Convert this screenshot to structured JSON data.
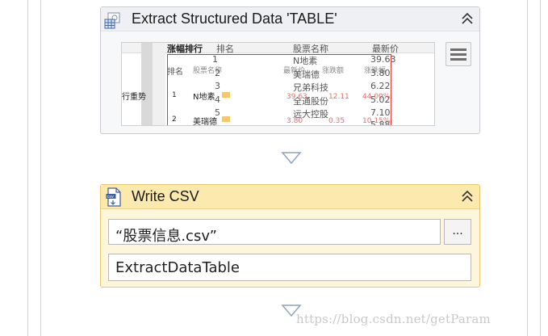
{
  "extract_activity": {
    "title": "Extract Structured Data 'TABLE'",
    "icon": "table-grid-icon",
    "collapse_icon": "double-chevron-up-icon",
    "menu_icon": "hamburger-menu-icon",
    "preview": {
      "header_row": [
        "涨幅排行",
        "排名",
        "股票名称",
        "最新价"
      ],
      "overlay_header": [
        "排名",
        "股票名称",
        "最新价",
        "涨跌额",
        "涨跌幅"
      ],
      "side_label": "行重势",
      "rows": [
        {
          "rank": "1",
          "name": "N地素",
          "price": "39.63"
        },
        {
          "rank": "2",
          "name": "美瑞德",
          "price": "3.80"
        },
        {
          "rank": "3",
          "name": "兄弟科技",
          "price": "6.22"
        },
        {
          "rank": "4",
          "name": "全通股份",
          "price": "5.02"
        },
        {
          "rank": "5",
          "name": "远大控股",
          "price": "7.10"
        },
        {
          "rank": "6",
          "name": "",
          "price": "5.88"
        }
      ],
      "overlay_rows": [
        {
          "rank": "1",
          "name": "N地素",
          "v1": "39.63",
          "v2": "12.11",
          "v3": "44.00%"
        },
        {
          "rank": "2",
          "name": "美瑞德",
          "v1": "3.80",
          "v2": "0.35",
          "v3": "10.15%"
        }
      ]
    }
  },
  "write_csv_activity": {
    "title": "Write CSV",
    "icon": "csv-file-icon",
    "collapse_icon": "double-chevron-up-icon",
    "file_path_value": "“股票信息.csv”",
    "browse_label": "...",
    "datatable_value": "ExtractDataTable"
  },
  "connector_icon": "down-triangle-arrow-icon",
  "watermark": "https://blog.csdn.net/getParam"
}
